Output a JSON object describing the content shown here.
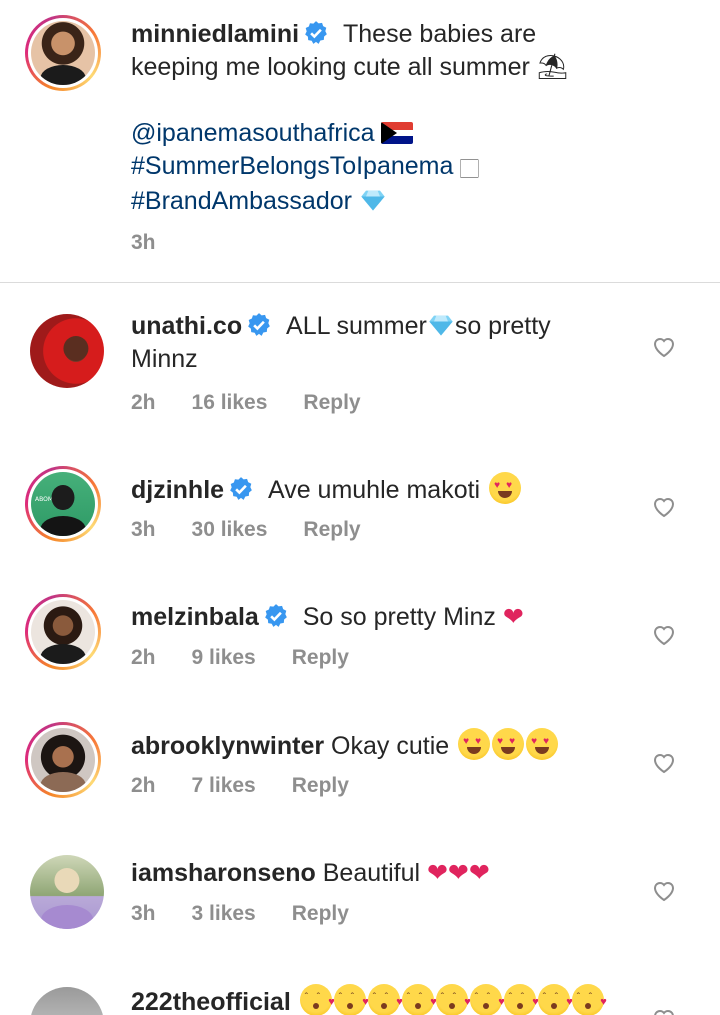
{
  "caption": {
    "username": "minniedlamini",
    "text_line1": "These babies are",
    "text_line2": "keeping me looking cute all summer ⛱",
    "mention": "@ipanemasouthafrica",
    "hashtag1": "#SummerBelongsToIpanema",
    "hashtag1_suffix": "🏻",
    "hashtag2": "#BrandAmbassador",
    "time": "3h"
  },
  "comments": [
    {
      "username": "unathi.co",
      "verified": true,
      "text_a": "ALL summer",
      "text_b": "so pretty",
      "text_c": "Minnz",
      "time": "2h",
      "likes": "16 likes",
      "reply": "Reply"
    },
    {
      "username": "djzinhle",
      "verified": true,
      "text": "Ave umuhle makoti",
      "time": "3h",
      "likes": "30 likes",
      "reply": "Reply",
      "avatar_tag": "ABOMSA"
    },
    {
      "username": "melzinbala",
      "verified": true,
      "text": "So so pretty Minz",
      "time": "2h",
      "likes": "9 likes",
      "reply": "Reply"
    },
    {
      "username": "abrooklynwinter",
      "verified": false,
      "text": "Okay cutie",
      "time": "2h",
      "likes": "7 likes",
      "reply": "Reply"
    },
    {
      "username": "iamsharonseno",
      "verified": false,
      "text": "Beautiful",
      "time": "3h",
      "likes": "3 likes",
      "reply": "Reply"
    },
    {
      "username": "222theofficial",
      "verified": false,
      "text": ""
    }
  ],
  "colors": {
    "link": "#00376b",
    "meta": "#8e8e8e",
    "verified": "#3897f0",
    "heart_emoji": "#e0245e"
  }
}
